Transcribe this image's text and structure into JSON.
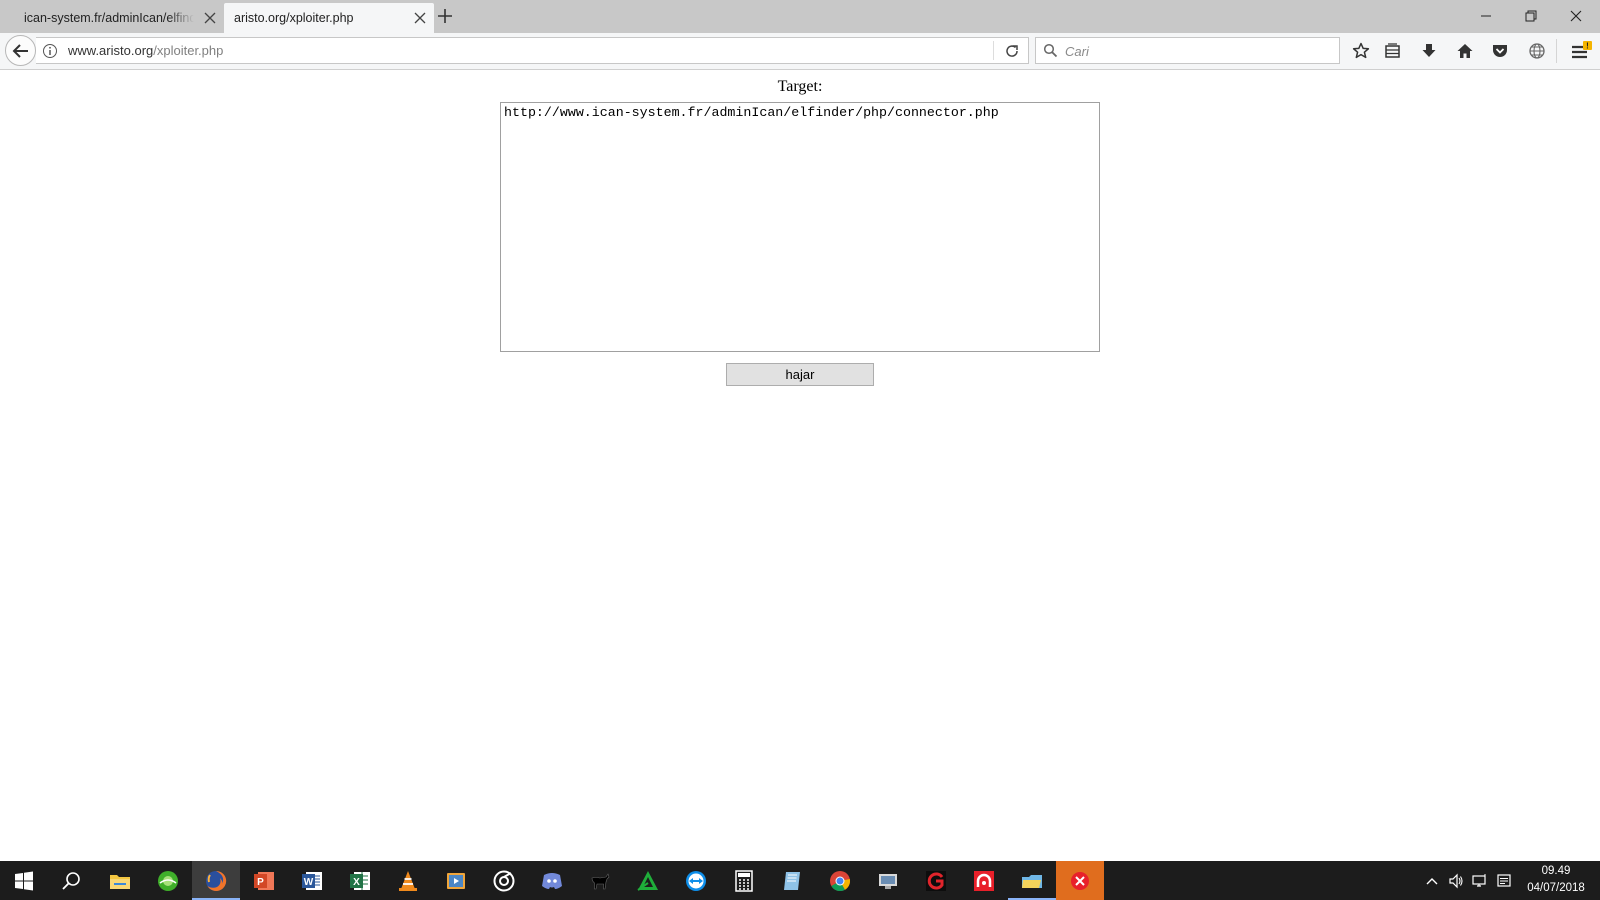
{
  "browser": {
    "tabs": [
      {
        "title": "ican-system.fr/adminIcan/elfinder/php/connector.php",
        "active": false
      },
      {
        "title": "aristo.org/xploiter.php",
        "active": true
      }
    ],
    "url": {
      "domain": "www.aristo.org",
      "path": "/xploiter.php"
    },
    "search": {
      "placeholder": "Cari"
    },
    "toolbar_icons": [
      "star-icon",
      "library-icon",
      "download-icon",
      "home-icon",
      "pocket-icon",
      "globe-icon",
      "menu-icon"
    ],
    "menu_badge": "!"
  },
  "form": {
    "label": "Target:",
    "textarea_value": "http://www.ican-system.fr/adminIcan/elfinder/php/connector.php",
    "submit_label": "hajar"
  },
  "taskbar": {
    "apps": [
      "start-icon",
      "search-icon",
      "file-explorer-icon",
      "green-app-icon",
      "firefox-icon",
      "powerpoint-icon",
      "word-icon",
      "excel-icon",
      "vlc-icon",
      "media-player-icon",
      "circle-app-icon",
      "discord-icon",
      "goat-icon",
      "green-triangle-icon",
      "teamviewer-icon",
      "calculator-icon",
      "paper-app-icon",
      "chrome-icon",
      "display-app-icon",
      "red-g-app-icon",
      "red-circle-app-icon",
      "folder-app-icon",
      "x-app-icon"
    ],
    "time": "09.49",
    "date": "04/07/2018"
  },
  "colors": {
    "tabstrip": "#c8c8c8",
    "toolbar": "#f5f6f7",
    "taskbar": "#1c1c1c",
    "alert": "#e06d1e"
  }
}
